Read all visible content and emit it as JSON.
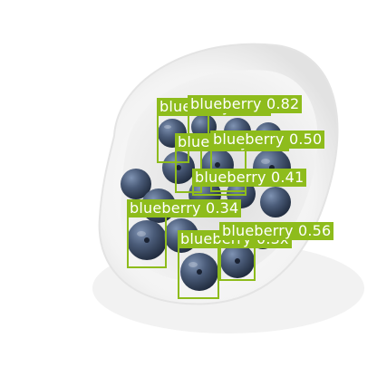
{
  "image": {
    "subject": "white oval ceramic bowl filled with blueberries on a white background",
    "colors": {
      "background": "#ffffff",
      "bowl": "#f4f4f4",
      "berry": "#3f4f6b",
      "box": "#8ebc1c",
      "label_text": "#ffffff"
    }
  },
  "detections": [
    {
      "label": "blueberry",
      "score": "0.82",
      "text": "blueberry 0.82"
    },
    {
      "label": "blueberry",
      "score": "0.50",
      "text": "blueberry 0.50"
    },
    {
      "label": "blueberry",
      "score": "0.41",
      "text": "blueberry 0.41"
    },
    {
      "label": "blueberry",
      "score": "0.34",
      "text": "blueberry 0.34"
    },
    {
      "label": "blueberry",
      "score": "0.56",
      "text": "blueberry 0.56"
    },
    {
      "label": "blueberry",
      "score": "0.3x",
      "text": "blueberry 0.3x"
    },
    {
      "label": "blueberry",
      "score": "0.3x",
      "text": "blueberry 0.3x"
    },
    {
      "label": "blueberry",
      "score": "0.5x",
      "text": "blueberry 0.5x"
    }
  ]
}
